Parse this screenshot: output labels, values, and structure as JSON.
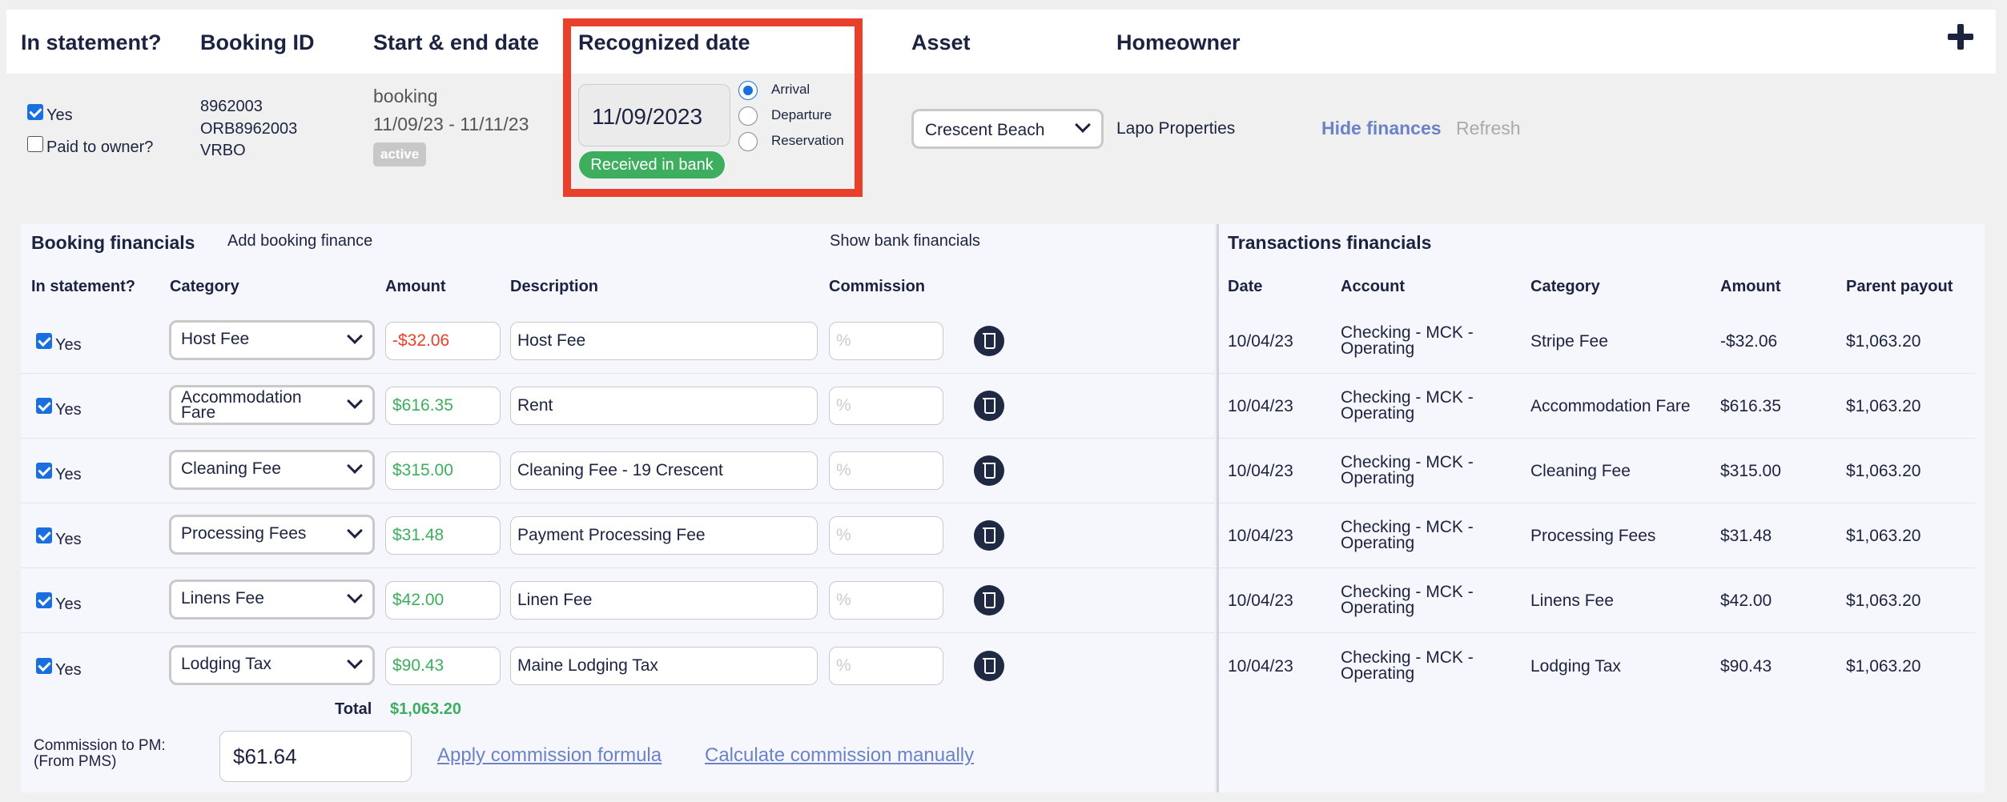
{
  "header": {
    "cols": [
      "In statement?",
      "Booking ID",
      "Start & end date",
      "Recognized date",
      "Asset",
      "Homeowner"
    ]
  },
  "booking": {
    "yes_label": "Yes",
    "paid_label": "Paid to owner?",
    "ids": [
      "8962003",
      "ORB8962003",
      "VRBO"
    ],
    "type": "booking",
    "dates": "11/09/23 - 11/11/23",
    "status": "active",
    "recognized_date": "11/09/2023",
    "radio_options": [
      "Arrival",
      "Departure",
      "Reservation"
    ],
    "selected_radio": "Arrival",
    "bank_status": "Received in bank",
    "asset": "Crescent Beach",
    "homeowner": "Lapo Properties",
    "hide_finances": "Hide finances",
    "refresh": "Refresh"
  },
  "colors": {
    "accent": "#1a6fe0",
    "highlight": "#e8402a",
    "green": "#3cae5e",
    "negative": "#e8402a"
  },
  "financials": {
    "title": "Booking financials",
    "add_label": "Add booking finance",
    "show_bank": "Show bank financials",
    "cols": [
      "In statement?",
      "Category",
      "Amount",
      "Description",
      "Commission"
    ],
    "rows": [
      {
        "yes": "Yes",
        "category": "Host Fee",
        "amount": "-$32.06",
        "description": "Host Fee",
        "commission_placeholder": "%"
      },
      {
        "yes": "Yes",
        "category": "Accommodation Fare",
        "amount": "$616.35",
        "description": "Rent",
        "commission_placeholder": "%"
      },
      {
        "yes": "Yes",
        "category": "Cleaning Fee",
        "amount": "$315.00",
        "description": "Cleaning Fee - 19 Crescent",
        "commission_placeholder": "%"
      },
      {
        "yes": "Yes",
        "category": "Processing Fees",
        "amount": "$31.48",
        "description": "Payment Processing Fee",
        "commission_placeholder": "%"
      },
      {
        "yes": "Yes",
        "category": "Linens Fee",
        "amount": "$42.00",
        "description": "Linen Fee",
        "commission_placeholder": "%"
      },
      {
        "yes": "Yes",
        "category": "Lodging Tax",
        "amount": "$90.43",
        "description": "Maine Lodging Tax",
        "commission_placeholder": "%"
      }
    ],
    "total_label": "Total",
    "total": "$1,063.20",
    "commission_label": "Commission to PM:",
    "commission_sub": "(From PMS)",
    "commission_value": "$61.64",
    "apply_formula": "Apply commission formula",
    "calc_manual": "Calculate commission manually"
  },
  "transactions": {
    "title": "Transactions financials",
    "cols": [
      "Date",
      "Account",
      "Category",
      "Amount",
      "Parent payout"
    ],
    "rows": [
      {
        "date": "10/04/23",
        "account1": "Checking - MCK -",
        "account2": "Operating",
        "category": "Stripe Fee",
        "amount": "-$32.06",
        "payout": "$1,063.20"
      },
      {
        "date": "10/04/23",
        "account1": "Checking - MCK -",
        "account2": "Operating",
        "category": "Accommodation Fare",
        "amount": "$616.35",
        "payout": "$1,063.20"
      },
      {
        "date": "10/04/23",
        "account1": "Checking - MCK -",
        "account2": "Operating",
        "category": "Cleaning Fee",
        "amount": "$315.00",
        "payout": "$1,063.20"
      },
      {
        "date": "10/04/23",
        "account1": "Checking - MCK -",
        "account2": "Operating",
        "category": "Processing Fees",
        "amount": "$31.48",
        "payout": "$1,063.20"
      },
      {
        "date": "10/04/23",
        "account1": "Checking - MCK -",
        "account2": "Operating",
        "category": "Linens Fee",
        "amount": "$42.00",
        "payout": "$1,063.20"
      },
      {
        "date": "10/04/23",
        "account1": "Checking - MCK -",
        "account2": "Operating",
        "category": "Lodging Tax",
        "amount": "$90.43",
        "payout": "$1,063.20"
      }
    ]
  }
}
